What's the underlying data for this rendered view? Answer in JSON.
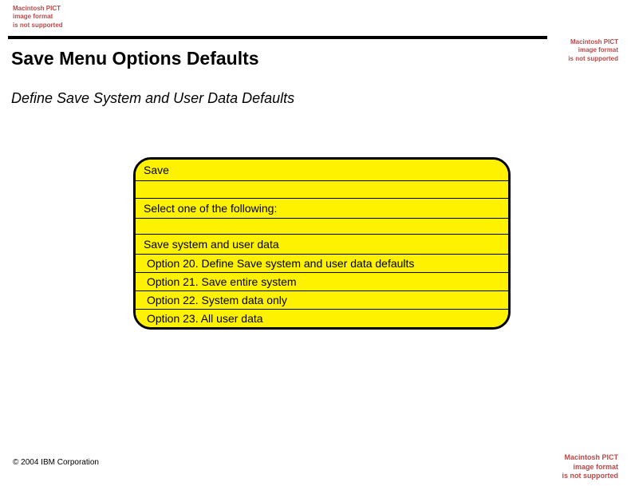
{
  "placeholders": {
    "text": "Macintosh PICT\nimage format\nis not supported"
  },
  "title": "Save Menu Options Defaults",
  "subtitle": "Define Save System and User Data Defaults",
  "menu": {
    "heading": "Save",
    "prompt": "Select one of the following:",
    "group": "Save system and user data",
    "options": [
      "Option 20. Define Save system and user data defaults",
      "Option 21. Save entire system",
      "Option 22. System data only",
      "Option 23. All user data"
    ]
  },
  "copyright": "© 2004 IBM Corporation"
}
